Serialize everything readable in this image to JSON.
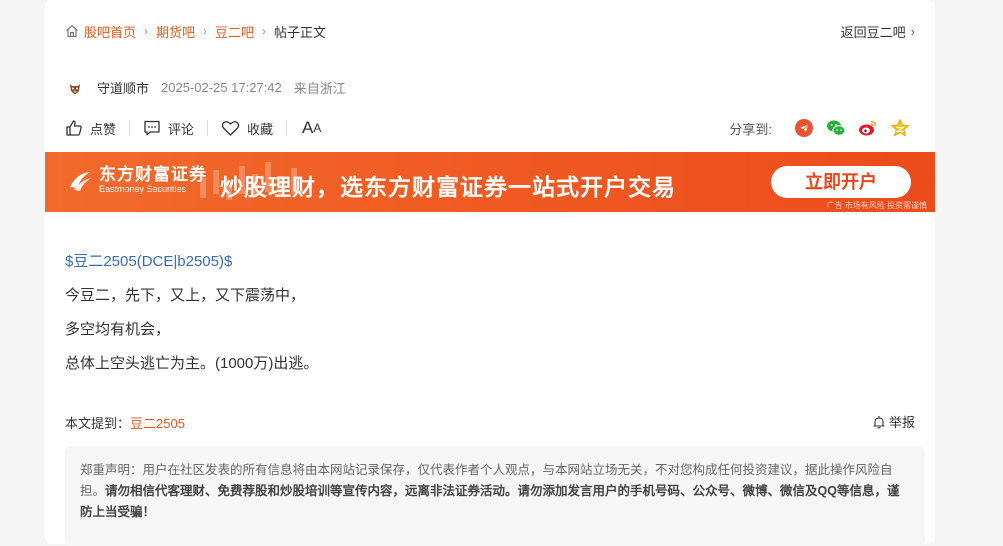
{
  "breadcrumb": {
    "items": [
      "股吧首页",
      "期货吧",
      "豆二吧"
    ],
    "current": "帖子正文",
    "back": "返回豆二吧"
  },
  "author": {
    "name": "守道顺市",
    "time": "2025-02-25 17:27:42",
    "from": "来自浙江"
  },
  "toolbar": {
    "like": "点赞",
    "comment": "评论",
    "favorite": "收藏",
    "font_big": "A",
    "font_small": "A",
    "share_label": "分享到:"
  },
  "banner": {
    "logo_cn": "东方财富证券",
    "logo_en": "Eastmoney Securities",
    "slogan": "炒股理财，选东方财富证券一站式开户交易",
    "cta": "立即开户",
    "ad_note": "广告 市场有风险 投资需谨慎"
  },
  "post": {
    "tag": "$豆二2505(DCE|b2505)$",
    "lines": [
      "今豆二，先下，又上，又下震荡中，",
      "多空均有机会，",
      "总体上空头逃亡为主。(1000万)出逃。"
    ]
  },
  "mention": {
    "label": "本文提到：",
    "link": "豆二2505"
  },
  "report": "举报",
  "disclaimer": {
    "normal": "郑重声明：用户在社区发表的所有信息将由本网站记录保存，仅代表作者个人观点，与本网站立场无关，不对您构成任何投资建议，据此操作风险自担。",
    "bold": "请勿相信代客理财、免费荐股和炒股培训等宣传内容，远离非法证券活动。请勿添加发言用户的手机号码、公众号、微博、微信及QQ等信息，谨防上当受骗！"
  },
  "colors": {
    "accent": "#e65a1f",
    "link_blue": "#3a6bb0",
    "banner": "#f05a22"
  },
  "icons": [
    "home-icon",
    "chevron-right-icon",
    "thumbs-up-icon",
    "comment-icon",
    "heart-icon",
    "share-telegram-icon",
    "wechat-icon",
    "weibo-icon",
    "qzone-star-icon",
    "report-bell-icon"
  ]
}
